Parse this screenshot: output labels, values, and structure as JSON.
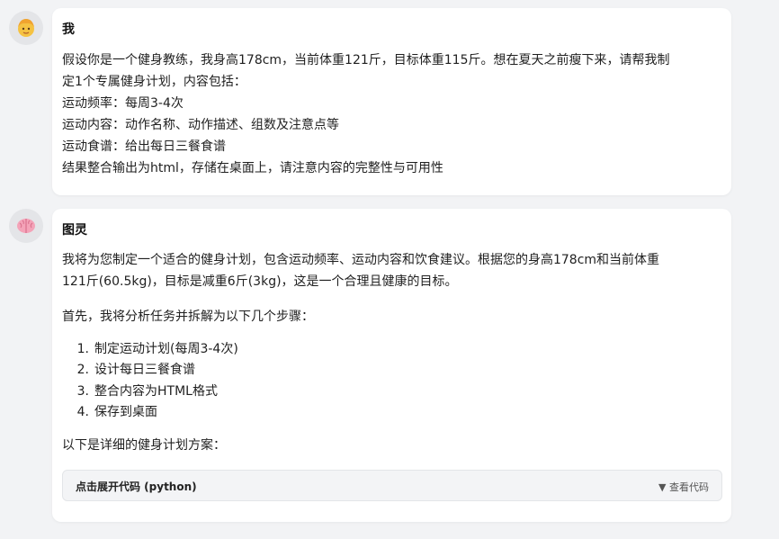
{
  "user_message": {
    "sender": "我",
    "lines": [
      "假设你是一个健身教练，我身高178cm，当前体重121斤，目标体重115斤。想在夏天之前瘦下来，请帮我制",
      "定1个专属健身计划，内容包括：",
      "运动频率：每周3-4次",
      "运动内容：动作名称、动作描述、组数及注意点等",
      "运动食谱：给出每日三餐食谱",
      "结果整合输出为html，存储在桌面上，请注意内容的完整性与可用性"
    ]
  },
  "assistant_message": {
    "sender": "图灵",
    "intro_lines": [
      "我将为您制定一个适合的健身计划，包含运动频率、运动内容和饮食建议。根据您的身高178cm和当前体重",
      "121斤(60.5kg)，目标是减重6斤(3kg)，这是一个合理且健康的目标。"
    ],
    "steps_intro": "首先，我将分析任务并拆解为以下几个步骤：",
    "steps": [
      {
        "num": "1.",
        "text": "制定运动计划(每周3-4次)"
      },
      {
        "num": "2.",
        "text": "设计每日三餐食谱"
      },
      {
        "num": "3.",
        "text": "整合内容为HTML格式"
      },
      {
        "num": "4.",
        "text": "保存到桌面"
      }
    ],
    "outro": "以下是详细的健身计划方案：",
    "code_block": {
      "title": "点击展开代码 (python)",
      "toggle_label": "▼ 查看代码"
    }
  }
}
